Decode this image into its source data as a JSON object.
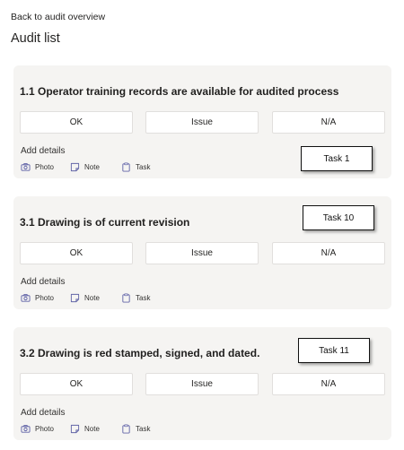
{
  "header": {
    "back_label": "Back to audit overview",
    "title": "Audit list"
  },
  "cards": [
    {
      "title": "1.1 Operator training records are available for audited process",
      "options": [
        "OK",
        "Issue",
        "N/A"
      ],
      "add_details": "Add details",
      "actions": [
        {
          "icon": "camera-icon",
          "label": "Photo"
        },
        {
          "icon": "note-icon",
          "label": "Note"
        },
        {
          "icon": "clipboard-icon",
          "label": "Task"
        }
      ],
      "task_label": "Task 1"
    },
    {
      "title": "3.1 Drawing is of current revision",
      "options": [
        "OK",
        "Issue",
        "N/A"
      ],
      "add_details": "Add details",
      "actions": [
        {
          "icon": "camera-icon",
          "label": "Photo"
        },
        {
          "icon": "note-icon",
          "label": "Note"
        },
        {
          "icon": "clipboard-icon",
          "label": "Task"
        }
      ],
      "task_label": "Task 10"
    },
    {
      "title": "3.2 Drawing is red stamped, signed, and dated.",
      "options": [
        "OK",
        "Issue",
        "N/A"
      ],
      "add_details": "Add details",
      "actions": [
        {
          "icon": "camera-icon",
          "label": "Photo"
        },
        {
          "icon": "note-icon",
          "label": "Note"
        },
        {
          "icon": "clipboard-icon",
          "label": "Task"
        }
      ],
      "task_label": "Task 11"
    }
  ],
  "colors": {
    "card_background": "#f5f4f2",
    "icon_accent": "#6264a7",
    "text": "#252423"
  }
}
